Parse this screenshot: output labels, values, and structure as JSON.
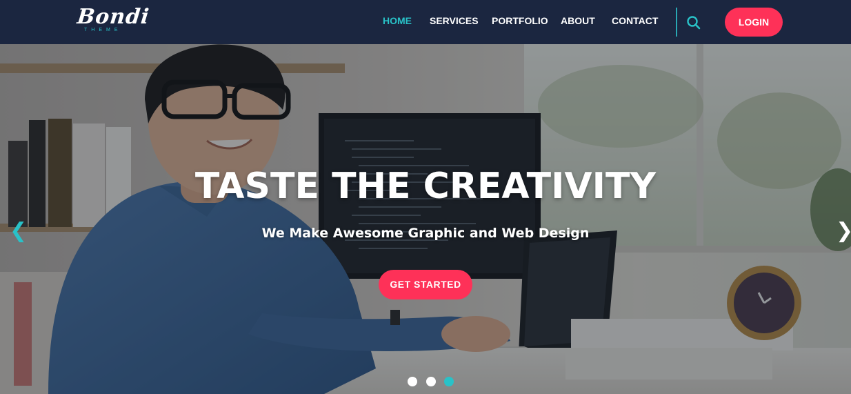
{
  "header": {
    "logo_text": "Bondi",
    "logo_subtext": "THEME",
    "nav": [
      {
        "label": "HOME",
        "active": true
      },
      {
        "label": "SERVICES",
        "active": false
      },
      {
        "label": "PORTFOLIO",
        "active": false
      },
      {
        "label": "ABOUT",
        "active": false
      },
      {
        "label": "CONTACT",
        "active": false
      }
    ],
    "search_icon": "search-icon",
    "login_label": "LOGIN"
  },
  "hero": {
    "title": "TASTE THE CREATIVITY",
    "subtitle": "We Make Awesome Graphic and Web Design",
    "cta_label": "GET STARTED",
    "prev_arrow": "❮",
    "next_arrow": "❯",
    "slides_total": 3,
    "active_slide": 3
  },
  "colors": {
    "navbar_bg": "#1b2640",
    "accent_teal": "#29c2c8",
    "accent_pink": "#fe3158",
    "text_white": "#ffffff",
    "dot_inactive": "#ffffff"
  }
}
